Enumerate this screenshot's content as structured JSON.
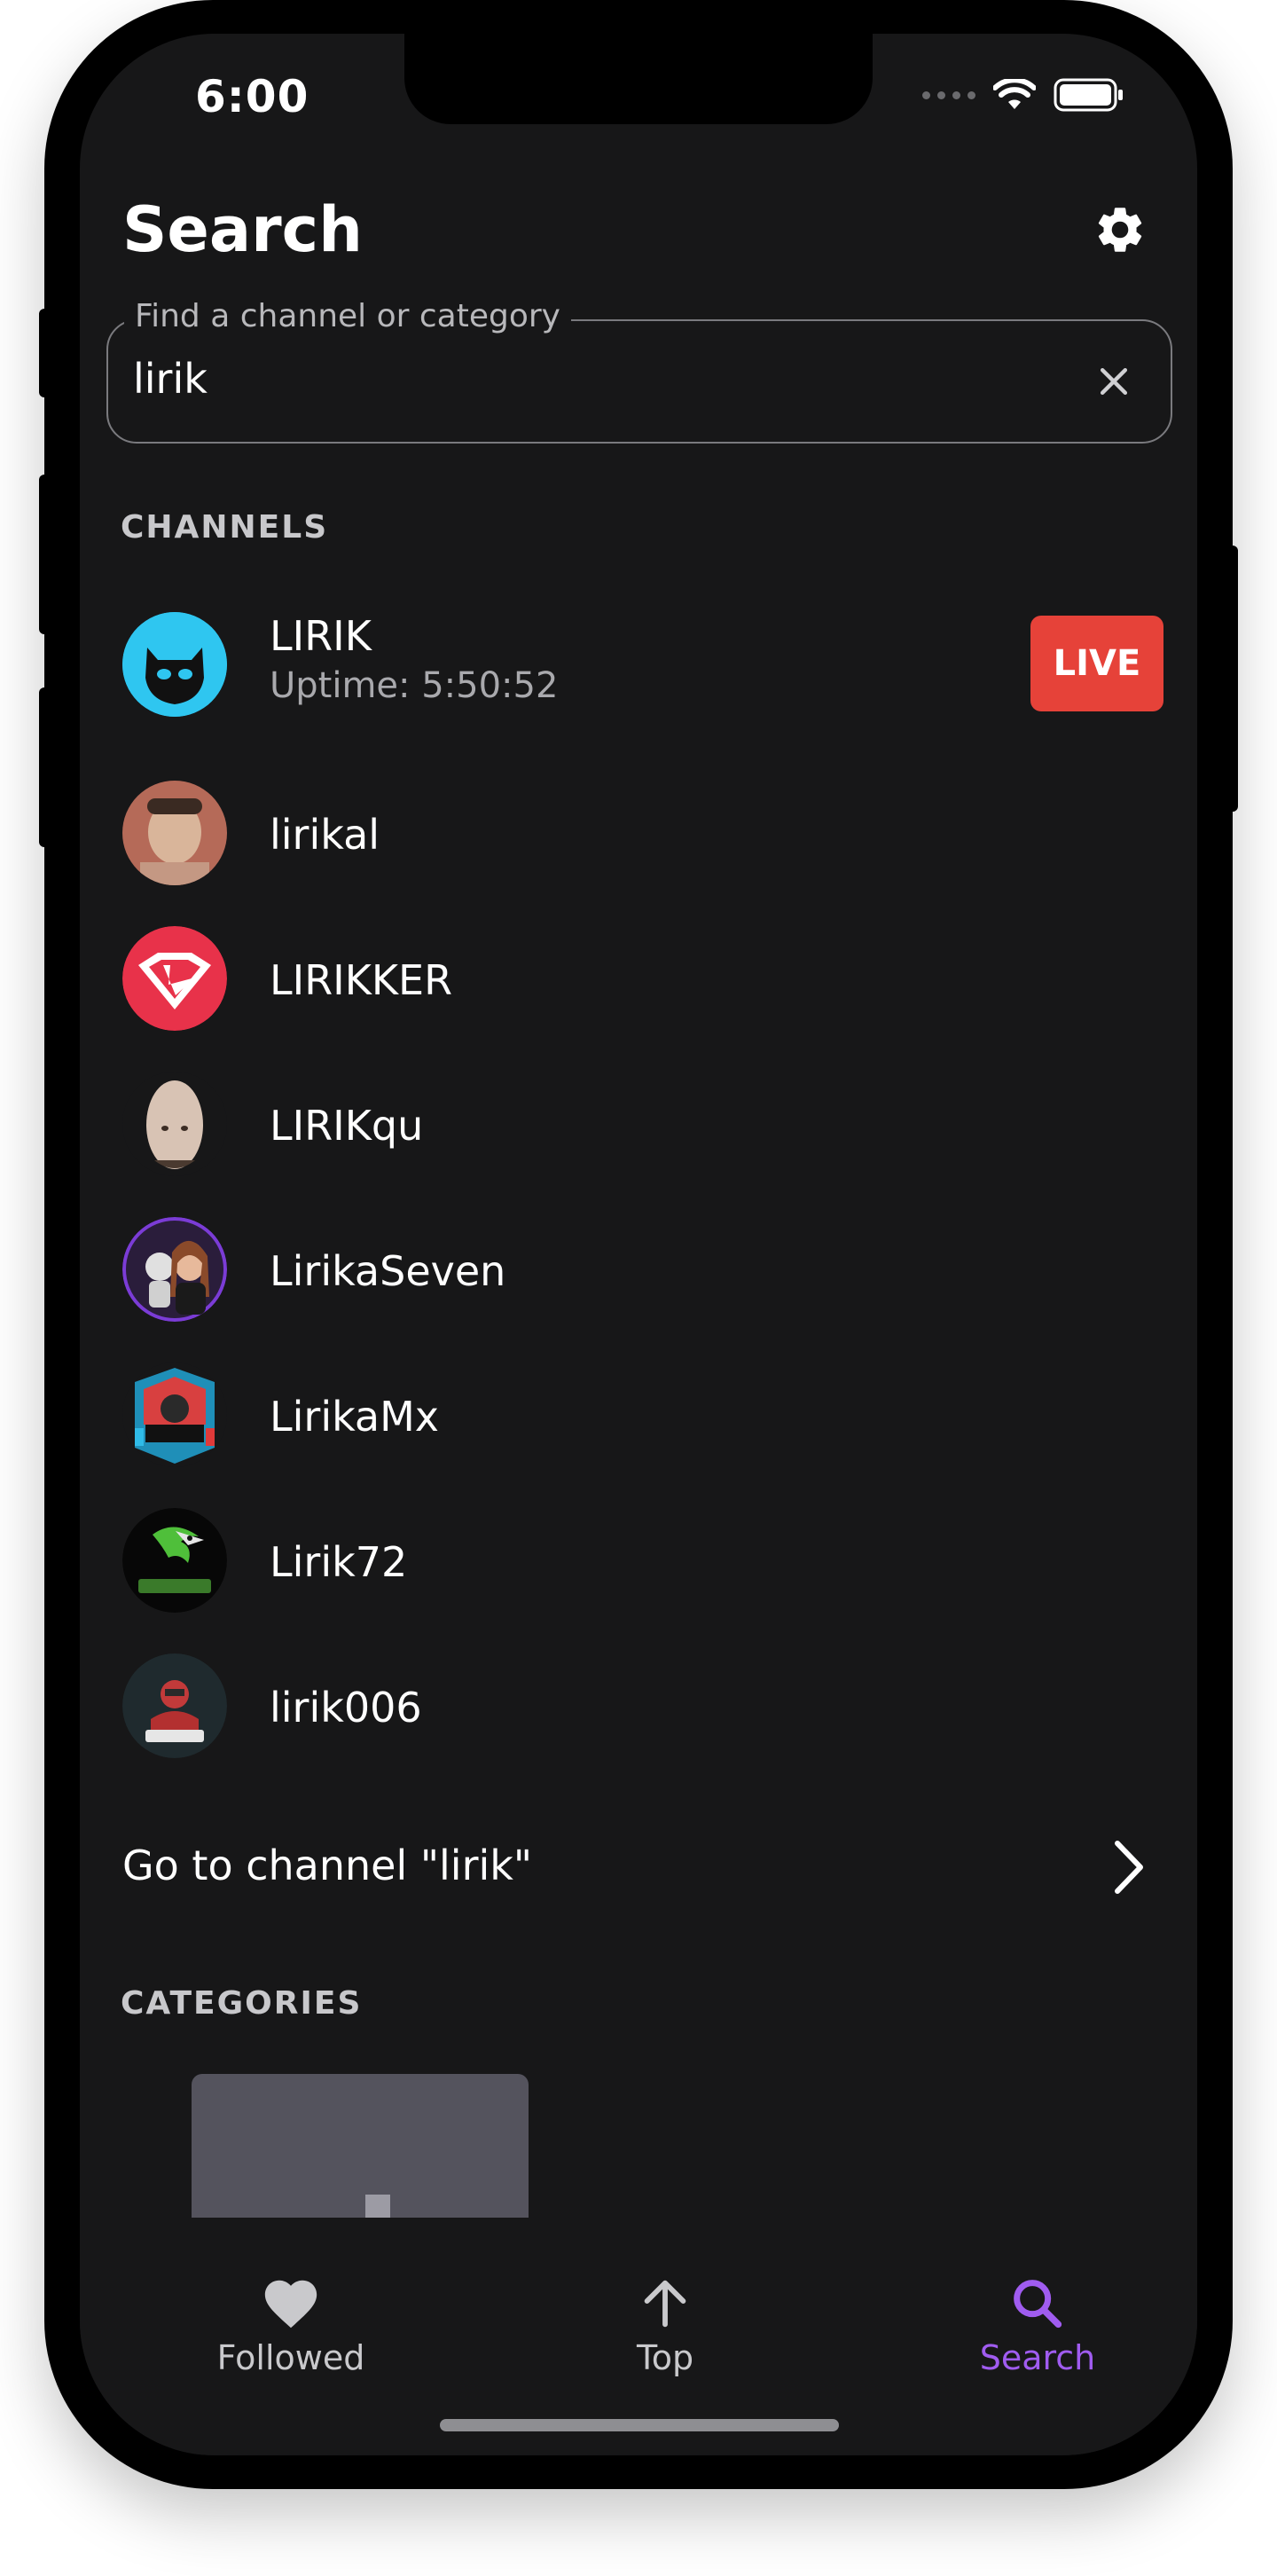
{
  "status_bar": {
    "time": "6:00"
  },
  "header": {
    "title": "Search",
    "settings_icon": "gear-icon"
  },
  "search": {
    "legend": "Find a channel or category",
    "value": "lirik",
    "clear_icon": "close-icon"
  },
  "channels_section": {
    "heading": "CHANNELS",
    "items": [
      {
        "name": "LIRIK",
        "subtitle": "Uptime: 5:50:52",
        "badge": "LIVE",
        "avatar_color": "#2fc6f0"
      },
      {
        "name": "lirikal",
        "avatar_color": "#b37a66"
      },
      {
        "name": "LIRIKKER",
        "avatar_color": "#e8324a"
      },
      {
        "name": "LIRIKqu",
        "avatar_color": "#d8c3b4"
      },
      {
        "name": "LirikaSeven",
        "avatar_color": "#2a1d3b"
      },
      {
        "name": "LirikaMx",
        "avatar_color": "#171718"
      },
      {
        "name": "Lirik72",
        "avatar_color": "#070707"
      },
      {
        "name": "lirik006",
        "avatar_color": "#1f2a2e"
      }
    ],
    "go_to_channel": "Go to channel \"lirik\""
  },
  "categories_section": {
    "heading": "CATEGORIES"
  },
  "tabbar": {
    "tabs": [
      {
        "label": "Followed",
        "icon": "heart-icon"
      },
      {
        "label": "Top",
        "icon": "arrow-up-icon"
      },
      {
        "label": "Search",
        "icon": "search-icon",
        "active": true
      }
    ],
    "active_color": "#a05cf0",
    "inactive_color": "#c9c9cc"
  },
  "colors": {
    "background": "#171718",
    "live_badge": "#e64239",
    "accent": "#a05cf0"
  }
}
